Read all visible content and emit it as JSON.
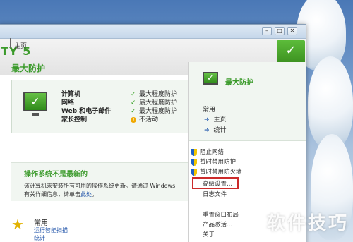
{
  "window": {
    "brand": "TY 5",
    "controls": [
      "–",
      "□",
      "✕"
    ],
    "status_check": "✓",
    "home_tab": "主页"
  },
  "main": {
    "title": "最大防护",
    "components": [
      {
        "label": "计算机",
        "status": "最大程度防护",
        "icon": "check-icon"
      },
      {
        "label": "网络",
        "status": "最大程度防护",
        "icon": "check-icon"
      },
      {
        "label": "Web 和电子邮件",
        "status": "最大程度防护",
        "icon": "check-icon"
      },
      {
        "label": "家长控制",
        "status": "不活动",
        "icon": "info-icon"
      }
    ],
    "warning_title": "操作系统不是最新的",
    "warning_text_1": "该计算机未安装所有可用的操作系统更新。请通过 Windows",
    "warning_text_2": "有关详细信息，请单击",
    "warning_link": "此处",
    "common_title": "常用",
    "common_link_1": "运行智能扫描",
    "common_link_2": "统计"
  },
  "panel": {
    "title": "最大防护",
    "common_heading": "常用",
    "links": [
      "主页",
      "统计"
    ],
    "actions": [
      "阻止网络",
      "暂时禁用防护",
      "暂时禁用防火墙"
    ],
    "menu_items": [
      "高级设置...",
      "日志文件",
      "重置窗口布局",
      "产品激活...",
      "关于"
    ]
  },
  "watermark": "软件技巧",
  "colors": {
    "accent_green": "#3a9a2a",
    "highlight_red": "#cc2b2b",
    "link_blue": "#2255aa"
  }
}
